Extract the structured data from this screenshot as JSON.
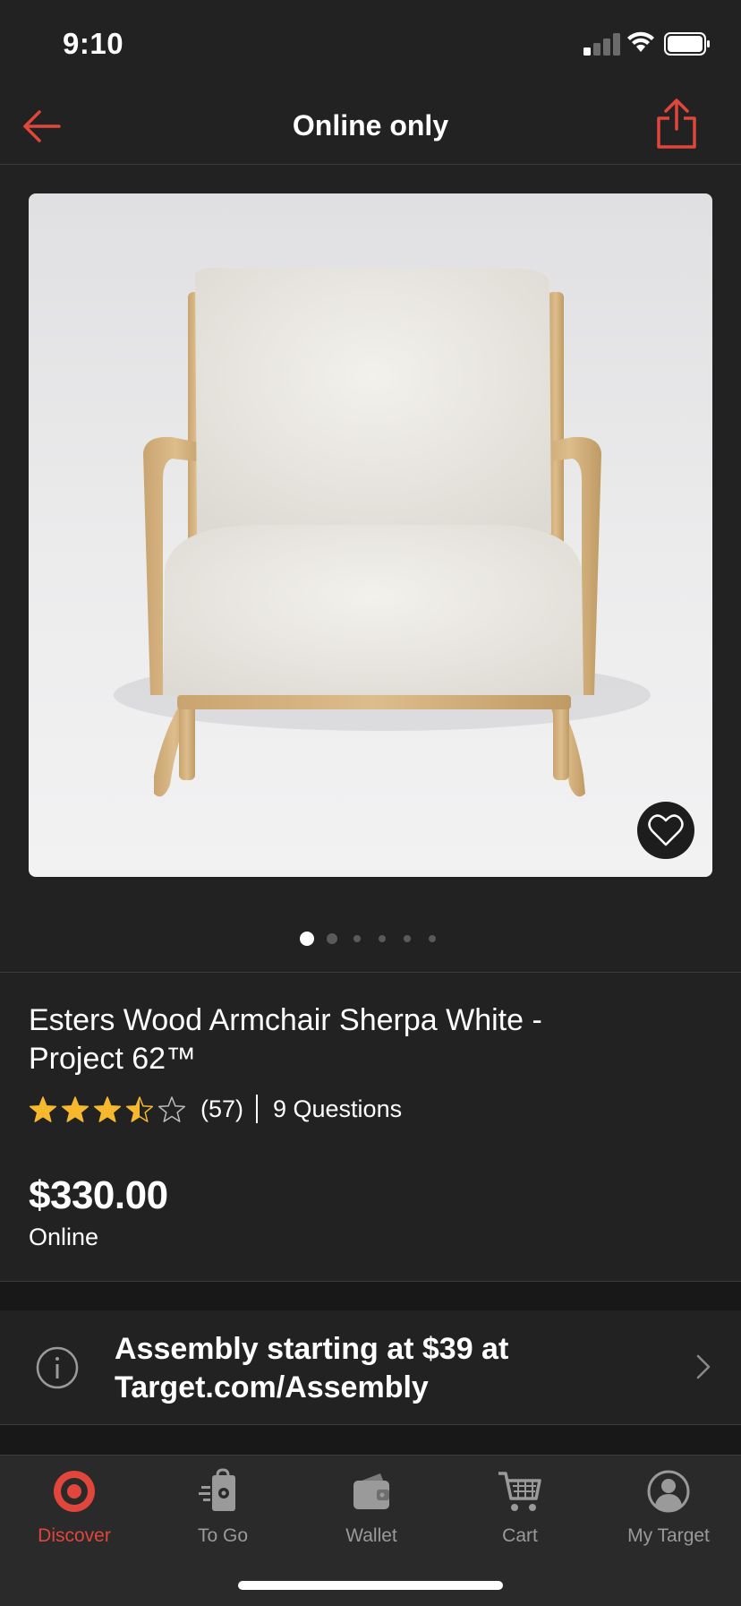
{
  "status_bar": {
    "time": "9:10"
  },
  "nav": {
    "title": "Online only",
    "back_icon": "arrow-left-icon",
    "share_icon": "share-icon"
  },
  "gallery": {
    "image_count": 6,
    "active_index": 0,
    "favorite_icon": "heart-icon"
  },
  "product": {
    "title_line1": "Esters Wood Armchair Sherpa White -",
    "title_line2": "Project 62™",
    "rating": 3.5,
    "rating_max": 5,
    "review_count": "(57)",
    "questions": "9 Questions",
    "price": "$330.00",
    "price_note": "Online"
  },
  "assembly": {
    "line1": "Assembly starting at $39 at",
    "line2": "Target.com/Assembly",
    "icon": "info-icon"
  },
  "tabs": [
    {
      "label": "Discover",
      "icon": "target-bullseye-icon",
      "active": true
    },
    {
      "label": "To Go",
      "icon": "shopping-bag-icon",
      "active": false
    },
    {
      "label": "Wallet",
      "icon": "wallet-icon",
      "active": false
    },
    {
      "label": "Cart",
      "icon": "cart-icon",
      "active": false
    },
    {
      "label": "My Target",
      "icon": "account-icon",
      "active": false
    }
  ],
  "colors": {
    "accent": "#e0463c",
    "star": "#f5b82e",
    "background": "#222222"
  }
}
